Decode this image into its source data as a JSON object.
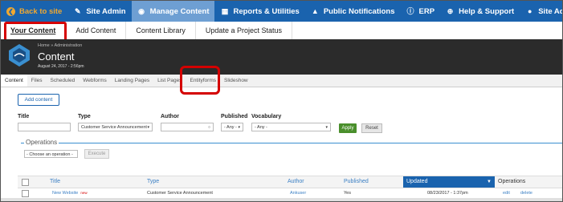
{
  "topbar": {
    "items": [
      {
        "label": "Back to site",
        "icon": "circle-arrow-left-icon"
      },
      {
        "label": "Site Admin",
        "icon": "wrench-icon"
      },
      {
        "label": "Manage Content",
        "icon": "content-icon"
      },
      {
        "label": "Reports & Utilities",
        "icon": "chart-icon"
      },
      {
        "label": "Public Notifications",
        "icon": "warning-icon"
      },
      {
        "label": "ERP",
        "icon": "info-icon"
      },
      {
        "label": "Help & Support",
        "icon": "lifebuoy-icon"
      },
      {
        "label": "Site Administrator",
        "icon": "user-icon"
      }
    ],
    "bg_color": "#1a63ae",
    "back_color": "#f0a830"
  },
  "subtabs": [
    "Your Content",
    "Add Content",
    "Content Library",
    "Update a Project Status"
  ],
  "header": {
    "breadcrumb": "Home » Administration",
    "title": "Content",
    "date": "August 24, 2017 - 2:56pm"
  },
  "content_tabs": [
    "Content",
    "Files",
    "Scheduled",
    "Webforms",
    "Landing Pages",
    "List Pages",
    "Entityforms",
    "Slideshow"
  ],
  "add_content_label": "Add content",
  "filters": {
    "title_label": "Title",
    "type_label": "Type",
    "type_value": "Customer Service Announcement",
    "author_label": "Author",
    "published_label": "Published",
    "published_value": "- Any -",
    "vocabulary_label": "Vocabulary",
    "vocabulary_value": "- Any -",
    "apply_label": "Apply",
    "reset_label": "Reset"
  },
  "operations": {
    "legend": "Operations",
    "select_value": "- Choose an operation -",
    "execute_label": "Execute"
  },
  "table": {
    "headers": [
      "Title",
      "Type",
      "Author",
      "Published",
      "Updated",
      "Operations"
    ],
    "rows": [
      {
        "title": "New Website",
        "badge": "new",
        "type": "Customer Service Announcement",
        "author": "Ankuser",
        "published": "Yes",
        "updated": "08/23/2017 - 1:37pm",
        "edit": "edit",
        "delete": "delete"
      }
    ]
  }
}
